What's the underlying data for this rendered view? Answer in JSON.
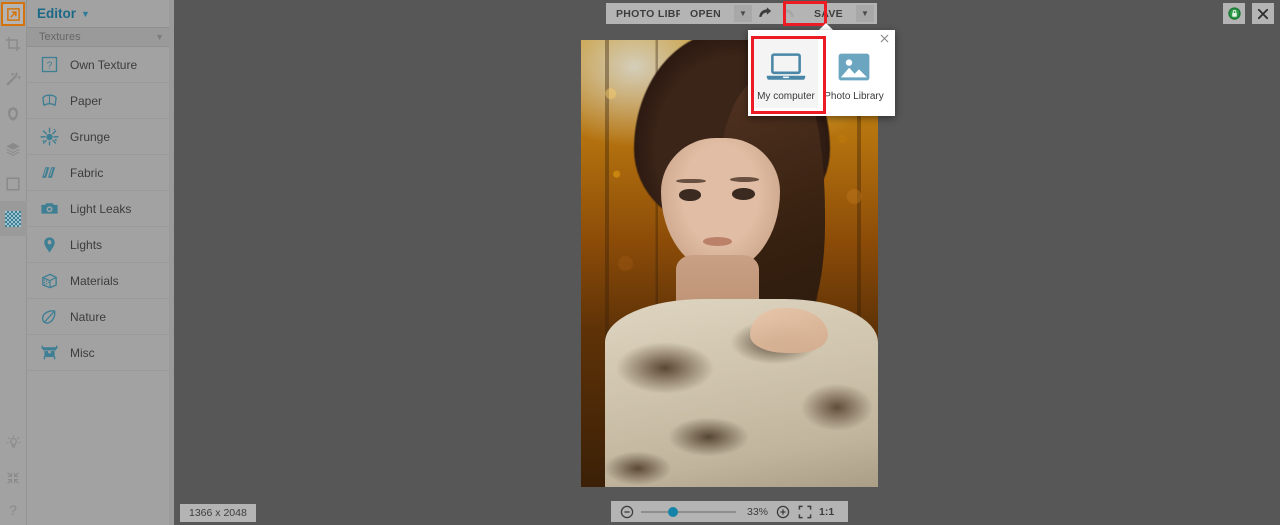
{
  "app": {
    "logo_icon": "polygon-arrow-logo-icon",
    "accent_teal": "#1c6986",
    "accent_orange": "#d4730c",
    "highlight_red": "#ed1c24"
  },
  "rail": {
    "items": [
      {
        "name": "crop-tool",
        "icon": "crop-icon"
      },
      {
        "name": "enhance-tool",
        "icon": "magic-wand-icon"
      },
      {
        "name": "retouch-tool",
        "icon": "portrait-icon"
      },
      {
        "name": "layers-tool",
        "icon": "layers-icon"
      },
      {
        "name": "frames-tool",
        "icon": "frame-icon"
      },
      {
        "name": "textures-tool",
        "icon": "texture-pattern-icon",
        "active": true
      }
    ],
    "bottom_items": [
      {
        "name": "tips-tool",
        "icon": "lightbulb-icon"
      },
      {
        "name": "fullscreen-tool",
        "icon": "collapse-arrows-icon"
      },
      {
        "name": "help-tool",
        "icon": "question-mark-icon"
      }
    ]
  },
  "sidebar": {
    "title": "Editor",
    "title_chevron": "chevron-down-icon",
    "section": {
      "label": "Textures",
      "chevron": "chevron-down-icon"
    },
    "items": [
      {
        "label": "Own Texture",
        "icon": "question-square-icon"
      },
      {
        "label": "Paper",
        "icon": "paper-icon"
      },
      {
        "label": "Grunge",
        "icon": "grunge-splat-icon"
      },
      {
        "label": "Fabric",
        "icon": "fabric-icon"
      },
      {
        "label": "Light Leaks",
        "icon": "camera-icon"
      },
      {
        "label": "Lights",
        "icon": "light-bulb-pin-icon"
      },
      {
        "label": "Materials",
        "icon": "cube-icon"
      },
      {
        "label": "Nature",
        "icon": "leaf-icon"
      },
      {
        "label": "Misc",
        "icon": "misc-box-icon"
      }
    ]
  },
  "toolbar": {
    "photo_library_label": "PHOTO LIBRARY",
    "open_label": "OPEN",
    "open_caret": "chevron-down-icon",
    "undo_icon": "undo-arrow-icon",
    "redo_icon": "redo-arrow-icon",
    "save_label": "SAVE",
    "save_caret": "chevron-down-icon",
    "secure_icon": "green-lock-badge-icon",
    "close_icon": "close-x-icon"
  },
  "save_popup": {
    "close_icon": "close-x-icon",
    "options": [
      {
        "label": "My computer",
        "icon": "laptop-icon",
        "selected": true
      },
      {
        "label": "Photo Library",
        "icon": "image-library-icon",
        "selected": false
      }
    ]
  },
  "status": {
    "image_size": "1366 x 2048"
  },
  "zoom_controls": {
    "zoom_out_icon": "minus-circle-icon",
    "zoom_in_icon": "plus-circle-icon",
    "fit_icon": "fit-screen-icon",
    "percent": "33%",
    "actual_size_label": "1:1",
    "slider_value": 33
  }
}
